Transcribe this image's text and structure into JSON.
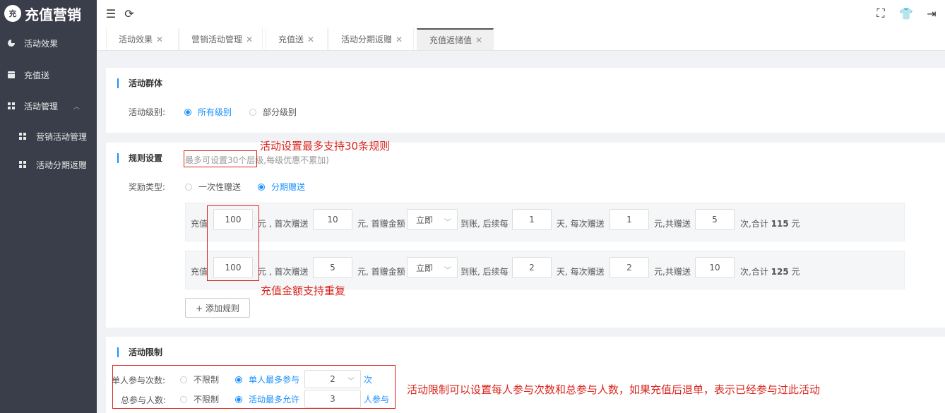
{
  "app": {
    "logo_mark": "充",
    "title": "充值营销"
  },
  "sidebar": {
    "items": [
      {
        "label": "活动效果",
        "icon": "pie-chart-icon"
      },
      {
        "label": "充值送",
        "icon": "gift-icon"
      },
      {
        "label": "活动管理",
        "icon": "grid-icon",
        "expanded": true
      },
      {
        "label": "营销活动管理",
        "icon": "grid-icon"
      },
      {
        "label": "活动分期返赠",
        "icon": "grid-icon"
      }
    ]
  },
  "topbar": {
    "menu_icon": "☰",
    "refresh_icon": "⟳",
    "fullscreen_icon": "⛶",
    "skin_icon": "👕",
    "logout_icon": "⇥"
  },
  "tabs": [
    {
      "label": "活动效果",
      "close": "✕"
    },
    {
      "label": "营销活动管理",
      "close": "✕"
    },
    {
      "label": "充值送",
      "close": "✕"
    },
    {
      "label": "活动分期返赠",
      "close": "✕"
    },
    {
      "label": "充值返储值",
      "close": "✕",
      "active": true
    }
  ],
  "group_section": {
    "title": "活动群体",
    "level_label": "活动级别:",
    "options": [
      {
        "label": "所有级别",
        "selected": true
      },
      {
        "label": "部分级别",
        "selected": false
      }
    ]
  },
  "rules_section": {
    "title": "规则设置",
    "hint": "最多可设置30个层级,每级优惠不累加)",
    "reward_type_label": "奖励类型:",
    "reward_options": [
      {
        "label": "一次性赠送",
        "selected": false
      },
      {
        "label": "分期赠送",
        "selected": true
      }
    ],
    "rules": [
      {
        "recharge": "100",
        "first_gift": "10",
        "timing": "立即",
        "interval_days": "1",
        "per_gift": "1",
        "times": "5",
        "total": "115"
      },
      {
        "recharge": "100",
        "first_gift": "5",
        "timing": "立即",
        "interval_days": "2",
        "per_gift": "2",
        "times": "10",
        "total": "125"
      }
    ],
    "text": {
      "recharge": "充值",
      "first_gift": "元 , 首次赠送",
      "first_amount": "元, 首赠金额",
      "arrive": "到账, 后续每",
      "each": "天, 每次赠送",
      "count": "元,共赠送",
      "sum_prefix": "次,合计",
      "yuan": "元"
    },
    "add_rule_label": "+ 添加规则"
  },
  "limit_section": {
    "title": "活动限制",
    "per_person_label": "单人参与次数:",
    "per_person_options": [
      {
        "label": "不限制",
        "selected": false
      },
      {
        "label": "单人最多参与",
        "selected": true
      }
    ],
    "per_person_value": "2",
    "per_person_unit": "次",
    "total_label": "总参与人数:",
    "total_options": [
      {
        "label": "不限制",
        "selected": false
      },
      {
        "label": "活动最多允许",
        "selected": true
      }
    ],
    "total_value": "3",
    "total_unit": "人参与"
  },
  "annotations": {
    "rules_limit": "活动设置最多支持30条规则",
    "repeat_amount": "充值金额支持重复",
    "limit_note": "活动限制可以设置每人参与次数和总参与人数，如果充值后退单，表示已经参与过此活动"
  },
  "colors": {
    "sidebar_bg": "#3a3e4a",
    "accent": "#1890ff",
    "annotation": "#d9251d"
  }
}
